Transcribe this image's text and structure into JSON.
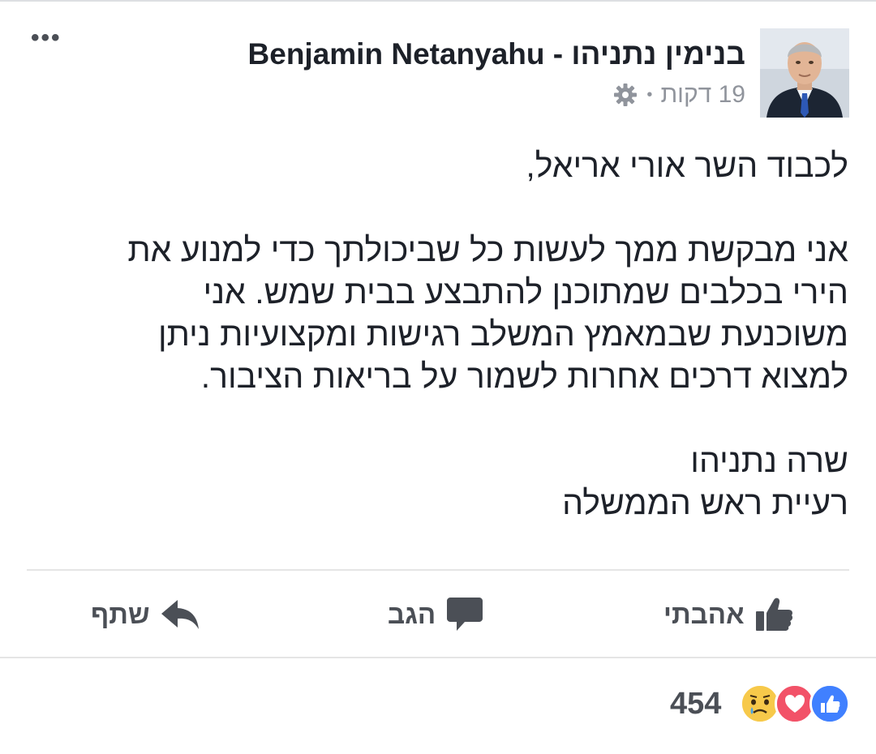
{
  "post": {
    "author": "בנימין נתניהו - Benjamin Netanyahu",
    "time": "19 דקות",
    "more_label": "•••",
    "paragraphs": [
      [
        "לכבוד השר אורי אריאל,"
      ],
      [
        "אני מבקשת ממך לעשות כל שביכולתך כדי למנוע את",
        "הירי בכלבים שמתוכנן להתבצע בבית שמש. אני",
        "משוכנעת שבמאמץ המשלב רגישות ומקצועיות ניתן",
        "למצוא דרכים אחרות לשמור על בריאות הציבור."
      ],
      [
        "שרה נתניהו",
        "רעיית ראש הממשלה"
      ]
    ]
  },
  "actions": {
    "like_label": "אהבתי",
    "comment_label": "הגב",
    "share_label": "שתף"
  },
  "reactions": {
    "types": [
      "like",
      "love",
      "sad"
    ],
    "count": "454"
  },
  "colors": {
    "like_blue": "#4080ff",
    "love_red": "#f25268",
    "sad_yellow": "#f7c94a",
    "text": "#1d2129",
    "muted": "#90949c",
    "action": "#4b4f56"
  }
}
